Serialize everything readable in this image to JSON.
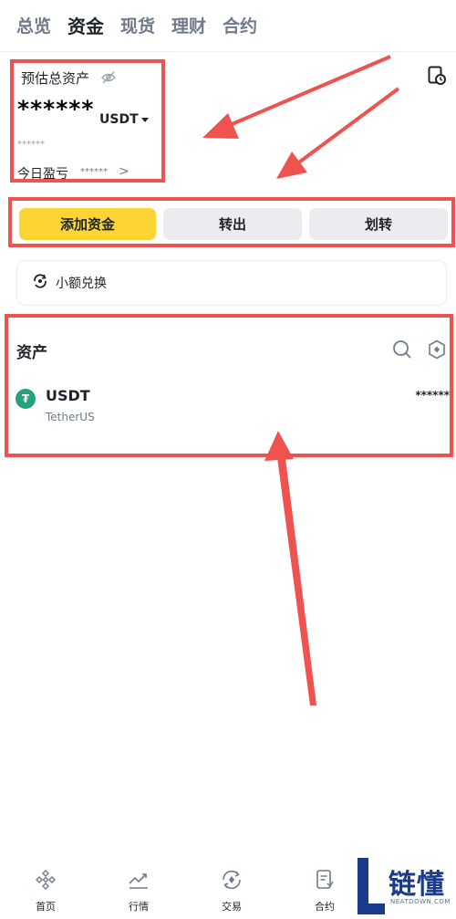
{
  "top_tabs": [
    {
      "label": "总览",
      "active": false
    },
    {
      "label": "资金",
      "active": true
    },
    {
      "label": "现货",
      "active": false
    },
    {
      "label": "理财",
      "active": false
    },
    {
      "label": "合约",
      "active": false
    }
  ],
  "summary": {
    "label": "预估总资产",
    "value": "******",
    "unit": "USDT",
    "sub_value": "******",
    "pnl_label": "今日盈亏",
    "pnl_value": "******",
    "pnl_chevron": ">"
  },
  "actions": {
    "deposit": "添加资金",
    "withdraw": "转出",
    "transfer": "划转"
  },
  "convert": {
    "label": "小额兑换"
  },
  "assets": {
    "title": "资产",
    "items": [
      {
        "symbol": "USDT",
        "name": "TetherUS",
        "amount": "******",
        "icon_glyph": "₮",
        "icon_color": "#26a17b"
      }
    ]
  },
  "bottom_nav": [
    {
      "label": "首页",
      "icon": "binance-logo-icon"
    },
    {
      "label": "行情",
      "icon": "chart-trend-icon"
    },
    {
      "label": "交易",
      "icon": "trade-swap-icon"
    },
    {
      "label": "合约",
      "icon": "futures-doc-icon"
    }
  ],
  "watermark": {
    "text": "链懂",
    "url": "NEATDOWN.COM"
  },
  "colors": {
    "accent_yellow": "#fcd535",
    "annotation_red": "#ef5350",
    "text_primary": "#1e2329",
    "text_secondary": "#707a8a"
  }
}
